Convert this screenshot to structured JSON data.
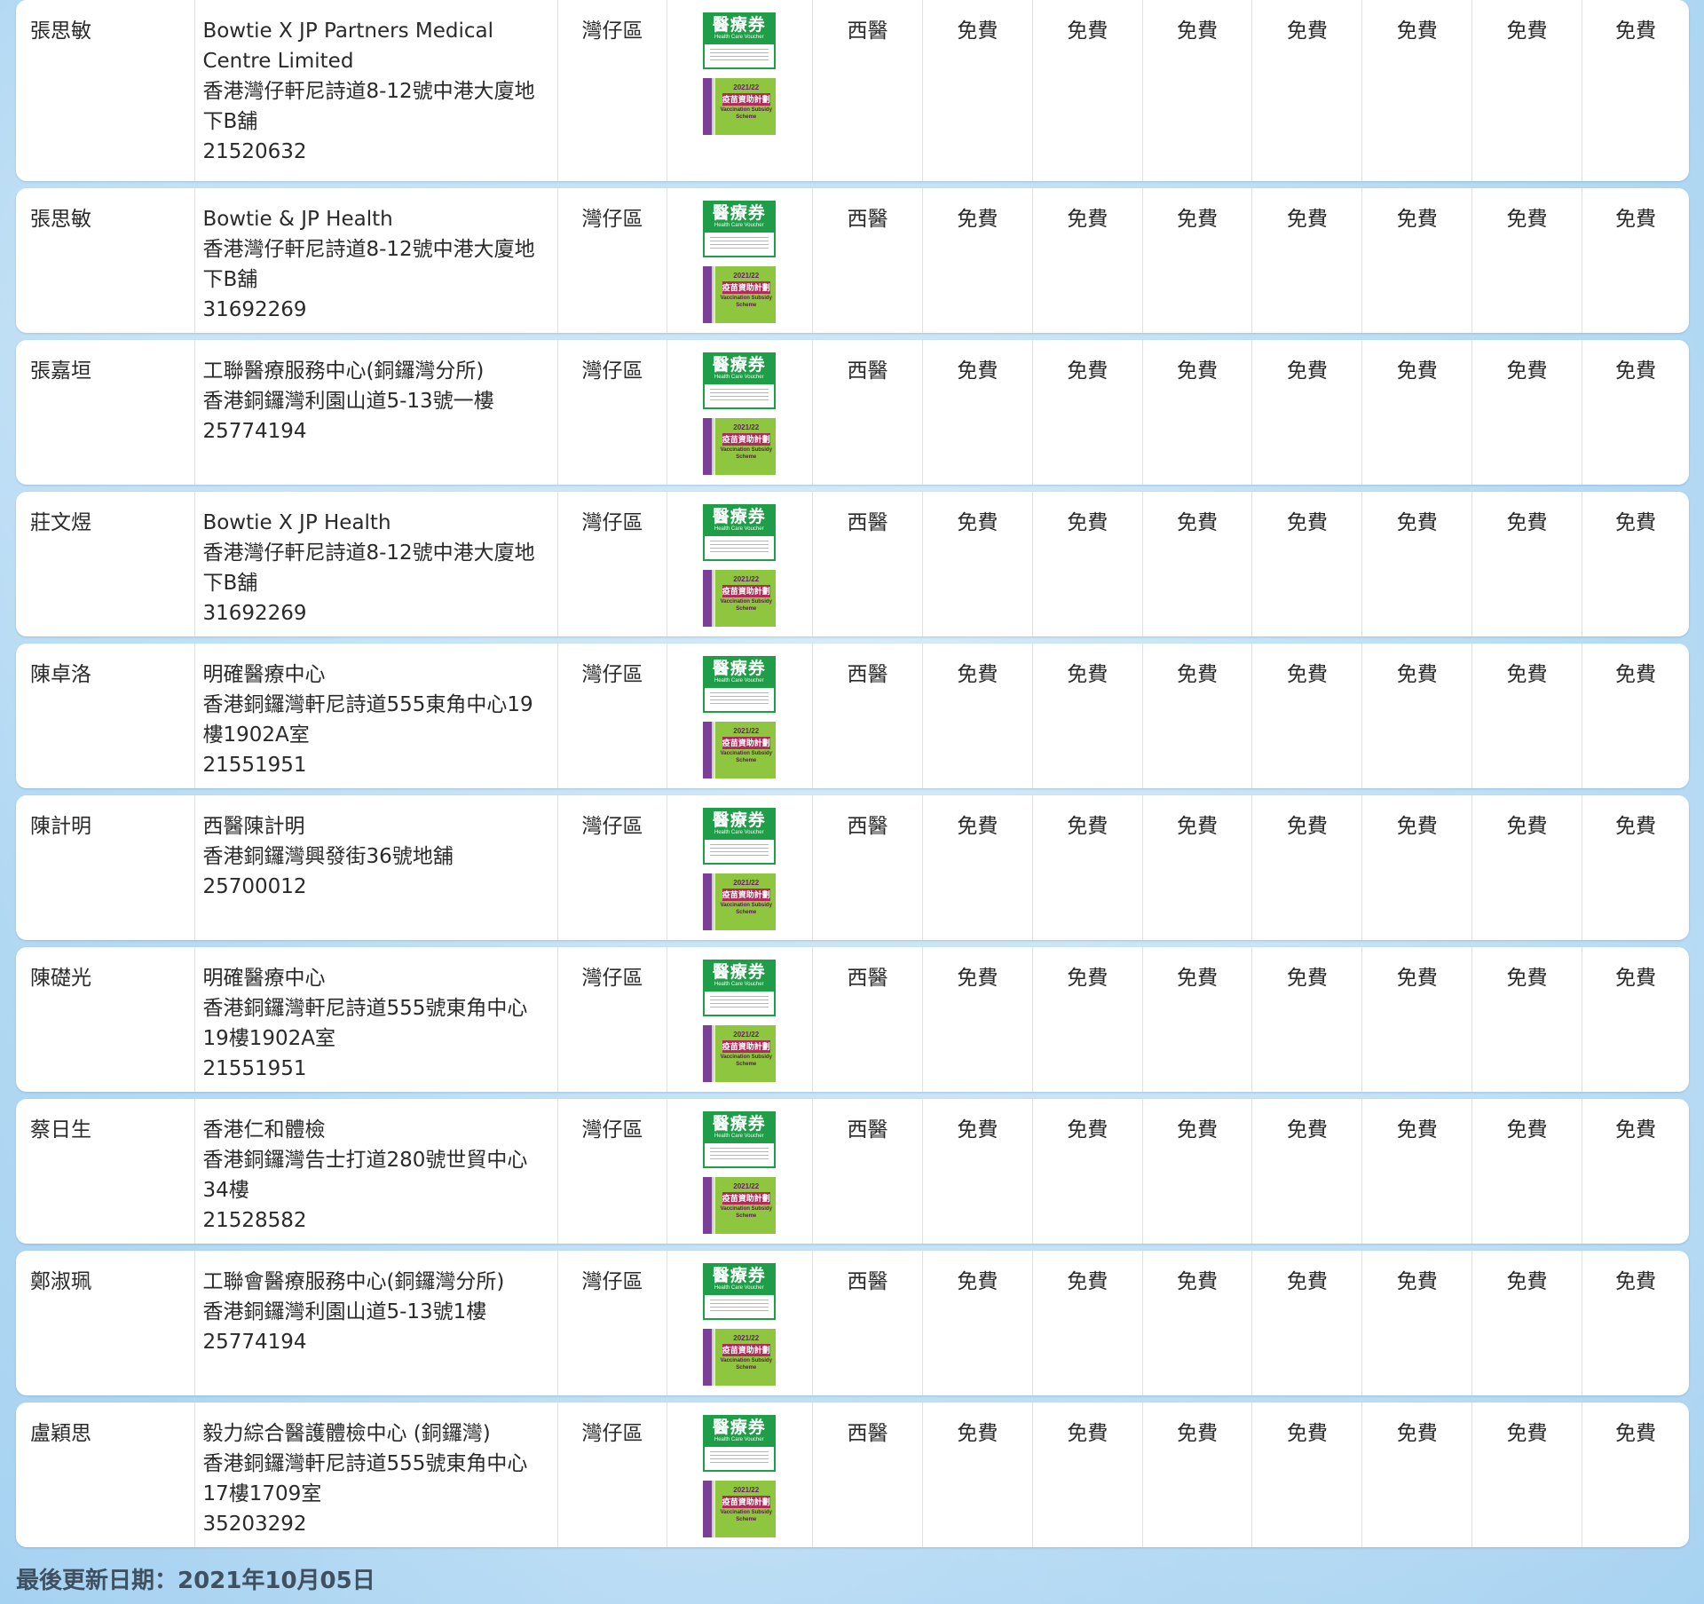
{
  "colors": {
    "page_background": "#b9dcf4",
    "row_background": "#ffffff",
    "voucher_green": "#1f9d48",
    "vss_green": "#8ec63f",
    "vss_purple": "#7b3f98",
    "footer_text": "#3f5060"
  },
  "badges": {
    "hcv": {
      "title": "醫療券",
      "subtitle": "Health Care Voucher",
      "icon": "health-care-voucher-icon"
    },
    "vss": {
      "year": "2021/22",
      "title": "疫苗資助計劃",
      "subtitle": "Vaccination Subsidy Scheme",
      "icon": "vaccination-subsidy-scheme-icon"
    }
  },
  "rows": [
    {
      "doctor": "張思敏",
      "clinic": [
        "Bowtie X JP Partners Medical Centre Limited",
        "香港灣仔軒尼詩道8-12號中港大廈地下B舖",
        "21520632"
      ],
      "district": "灣仔區",
      "type": "西醫",
      "fees": [
        "免費",
        "免費",
        "免費",
        "免費",
        "免費",
        "免費",
        "免費"
      ]
    },
    {
      "doctor": "張思敏",
      "clinic": [
        "Bowtie & JP Health",
        "香港灣仔軒尼詩道8-12號中港大廈地下B舖",
        "31692269"
      ],
      "district": "灣仔區",
      "type": "西醫",
      "fees": [
        "免費",
        "免費",
        "免費",
        "免費",
        "免費",
        "免費",
        "免費"
      ]
    },
    {
      "doctor": "張嘉垣",
      "clinic": [
        "工聯醫療服務中心(銅鑼灣分所)",
        "香港銅鑼灣利園山道5-13號一樓",
        "25774194"
      ],
      "district": "灣仔區",
      "type": "西醫",
      "fees": [
        "免費",
        "免費",
        "免費",
        "免費",
        "免費",
        "免費",
        "免費"
      ]
    },
    {
      "doctor": "莊文煜",
      "clinic": [
        "Bowtie X JP Health",
        "香港灣仔軒尼詩道8-12號中港大廈地下B舖",
        "31692269"
      ],
      "district": "灣仔區",
      "type": "西醫",
      "fees": [
        "免費",
        "免費",
        "免費",
        "免費",
        "免費",
        "免費",
        "免費"
      ]
    },
    {
      "doctor": "陳卓洛",
      "clinic": [
        "明確醫療中心",
        "香港銅鑼灣軒尼詩道555東角中心19樓1902A室",
        "21551951"
      ],
      "district": "灣仔區",
      "type": "西醫",
      "fees": [
        "免費",
        "免費",
        "免費",
        "免費",
        "免費",
        "免費",
        "免費"
      ]
    },
    {
      "doctor": "陳計明",
      "clinic": [
        "西醫陳計明",
        "香港銅鑼灣興發街36號地舖",
        "25700012"
      ],
      "district": "灣仔區",
      "type": "西醫",
      "fees": [
        "免費",
        "免費",
        "免費",
        "免費",
        "免費",
        "免費",
        "免費"
      ]
    },
    {
      "doctor": "陳礎光",
      "clinic": [
        "明確醫療中心",
        "香港銅鑼灣軒尼詩道555號東角中心19樓1902A室",
        "21551951"
      ],
      "district": "灣仔區",
      "type": "西醫",
      "fees": [
        "免費",
        "免費",
        "免費",
        "免費",
        "免費",
        "免費",
        "免費"
      ]
    },
    {
      "doctor": "蔡日生",
      "clinic": [
        "香港仁和體檢",
        "香港銅鑼灣告士打道280號世貿中心34樓",
        "21528582"
      ],
      "district": "灣仔區",
      "type": "西醫",
      "fees": [
        "免費",
        "免費",
        "免費",
        "免費",
        "免費",
        "免費",
        "免費"
      ]
    },
    {
      "doctor": "鄭淑珮",
      "clinic": [
        "工聯會醫療服務中心(銅鑼灣分所)",
        "香港銅鑼灣利園山道5-13號1樓",
        "25774194"
      ],
      "district": "灣仔區",
      "type": "西醫",
      "fees": [
        "免費",
        "免費",
        "免費",
        "免費",
        "免費",
        "免費",
        "免費"
      ]
    },
    {
      "doctor": "盧穎思",
      "clinic": [
        "毅力綜合醫護體檢中心 (銅鑼灣)",
        "香港銅鑼灣軒尼詩道555號東角中心17樓1709室",
        "35203292"
      ],
      "district": "灣仔區",
      "type": "西醫",
      "fees": [
        "免費",
        "免費",
        "免費",
        "免費",
        "免費",
        "免費",
        "免費"
      ]
    }
  ],
  "footer": {
    "last_updated": "最後更新日期：2021年10月05日"
  }
}
